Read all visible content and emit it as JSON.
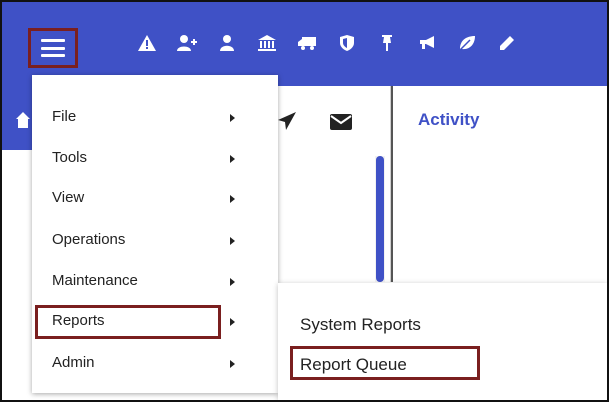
{
  "toolbar": {
    "icons": [
      "warning-icon",
      "add-user-icon",
      "user-icon",
      "bank-icon",
      "truck-icon",
      "shield-icon",
      "pin-icon",
      "megaphone-icon",
      "leaf-icon",
      "pencil-icon"
    ],
    "color": "#3f51c6",
    "highlight_color": "#7a1f1f"
  },
  "panel": {
    "activity_title": "Activity"
  },
  "menu": {
    "items": [
      {
        "label": "File"
      },
      {
        "label": "Tools"
      },
      {
        "label": "View"
      },
      {
        "label": "Operations"
      },
      {
        "label": "Maintenance"
      },
      {
        "label": "Reports"
      },
      {
        "label": "Admin"
      }
    ],
    "selected": "Reports"
  },
  "submenu": {
    "items": [
      {
        "label": "System Reports"
      },
      {
        "label": "Report Queue"
      }
    ],
    "selected": "Report Queue"
  }
}
